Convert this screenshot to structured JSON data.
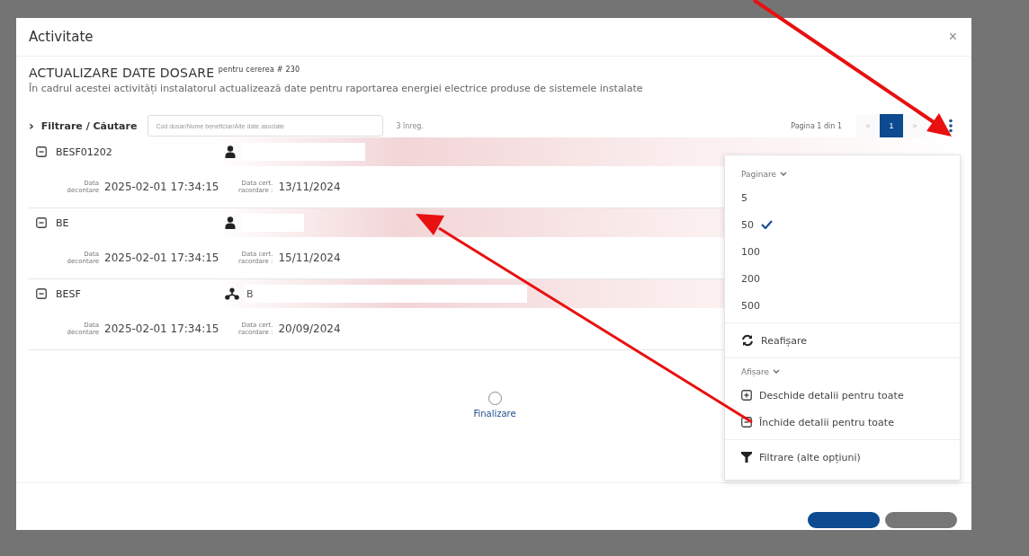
{
  "dialog": {
    "title": "Activitate",
    "close": "×"
  },
  "heading": "ACTUALIZARE DATE DOSARE $^{pentru cererea # 230}$",
  "description": "În cadrul acestei activități instalatorul actualizează date pentru raportarea energiei electrice produse de sistemele instalate",
  "filter": {
    "toggle": "›",
    "label": "Filtrare / Căutare",
    "placeholder": "Cod dosar/Nume beneficiar/Alte date asociate",
    "count": "3 înreg."
  },
  "pagination": {
    "info": "Pagina 1 din 1",
    "prev": "«",
    "next": "»",
    "pages": [
      {
        "label": "1",
        "selected": true
      }
    ]
  },
  "records": [
    {
      "code": "BESF01202",
      "expanded": true,
      "kind": "person",
      "fields": [
        {
          "label": "Data decontare",
          "value": "2025-02-01 17:34:15"
        },
        {
          "label": "Data cert. racordare :",
          "value": "13/11/2024"
        }
      ]
    },
    {
      "code": "BE",
      "expanded": true,
      "kind": "person",
      "fields": [
        {
          "label": "Data decontare",
          "value": "2025-02-01 17:34:15"
        },
        {
          "label": "Data cert. racordare :",
          "value": "15/11/2024"
        }
      ]
    },
    {
      "code": "BESF",
      "expanded": true,
      "kind": "group",
      "owner": "B",
      "fields": [
        {
          "label": "Data decontare",
          "value": "2025-02-01 17:34:15"
        },
        {
          "label": "Data cert. racordare :",
          "value": "20/09/2024"
        }
      ]
    }
  ],
  "step": {
    "label": "Finalizare",
    "done": false
  },
  "menu": {
    "groups": [
      {
        "title": "Paginare",
        "items": [
          {
            "kind": "option",
            "label": "5",
            "selected": false
          },
          {
            "kind": "option",
            "label": "50",
            "selected": true
          },
          {
            "kind": "option",
            "label": "100",
            "selected": false
          },
          {
            "kind": "option",
            "label": "200",
            "selected": false
          },
          {
            "kind": "option",
            "label": "500",
            "selected": false
          }
        ]
      },
      {
        "items": [
          {
            "kind": "refresh",
            "label": "Reafișare"
          }
        ]
      },
      {
        "title": "Afișare",
        "items": [
          {
            "kind": "expand",
            "label": "Deschide detalii pentru toate"
          },
          {
            "kind": "collapse",
            "label": "Închide detalii pentru toate"
          }
        ]
      },
      {
        "items": [
          {
            "kind": "filter",
            "label": "Filtrare (alte opțiuni)"
          }
        ]
      }
    ]
  }
}
